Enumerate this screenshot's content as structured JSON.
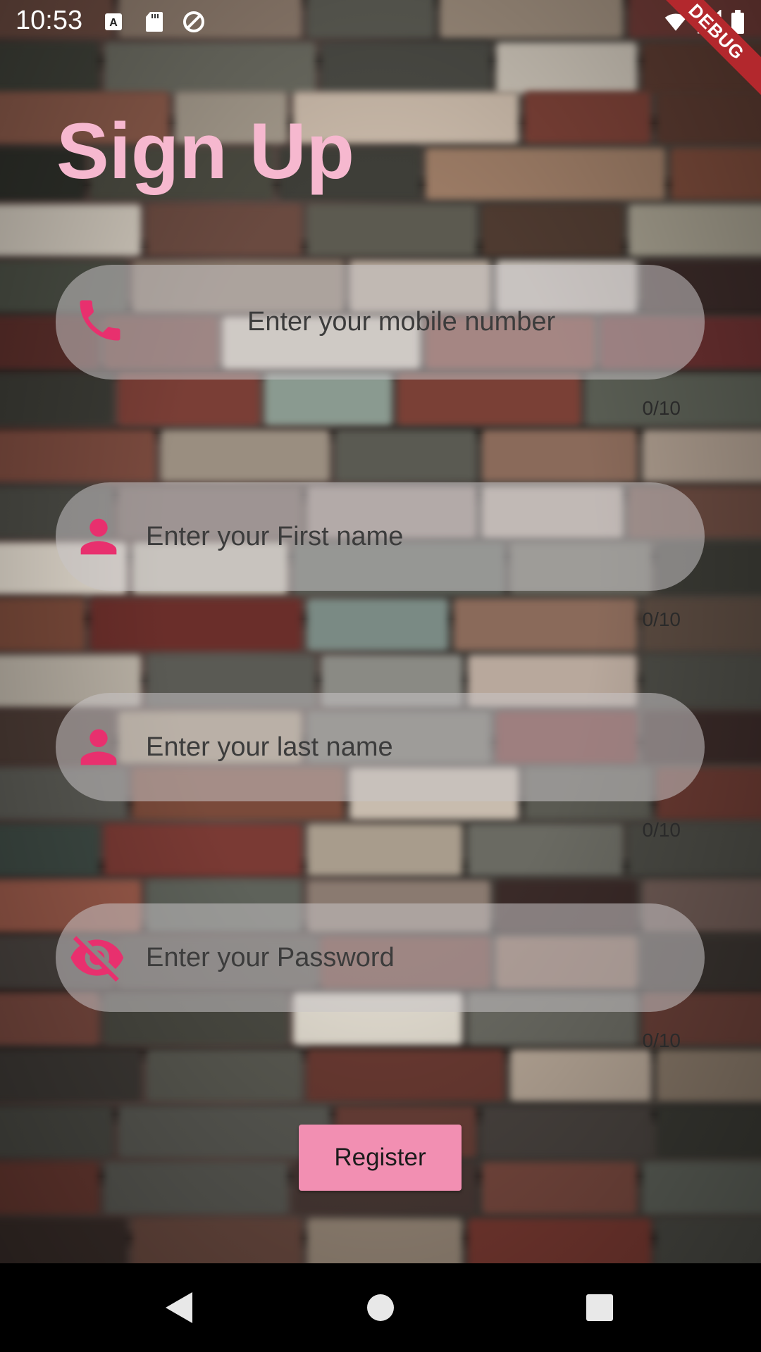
{
  "status_bar": {
    "time": "10:53",
    "debug_label": "DEBUG"
  },
  "page": {
    "title": "Sign Up",
    "accent_color": "#e8306e",
    "title_color": "#f6b8cf",
    "button_color": "#f28fb2"
  },
  "fields": [
    {
      "name": "mobile",
      "icon": "phone-icon",
      "placeholder": "Enter your mobile number",
      "value": "",
      "counter": "0/10"
    },
    {
      "name": "first-name",
      "icon": "person-icon",
      "placeholder": "Enter your First name",
      "value": "",
      "counter": "0/10"
    },
    {
      "name": "last-name",
      "icon": "person-icon",
      "placeholder": "Enter your last name",
      "value": "",
      "counter": "0/10"
    },
    {
      "name": "password",
      "icon": "visibility-off-icon",
      "placeholder": "Enter your Password",
      "value": "",
      "counter": "0/10"
    }
  ],
  "register_button": {
    "label": "Register"
  },
  "nav_bar": {
    "back": "back-icon",
    "home": "home-icon",
    "recents": "recents-icon"
  }
}
